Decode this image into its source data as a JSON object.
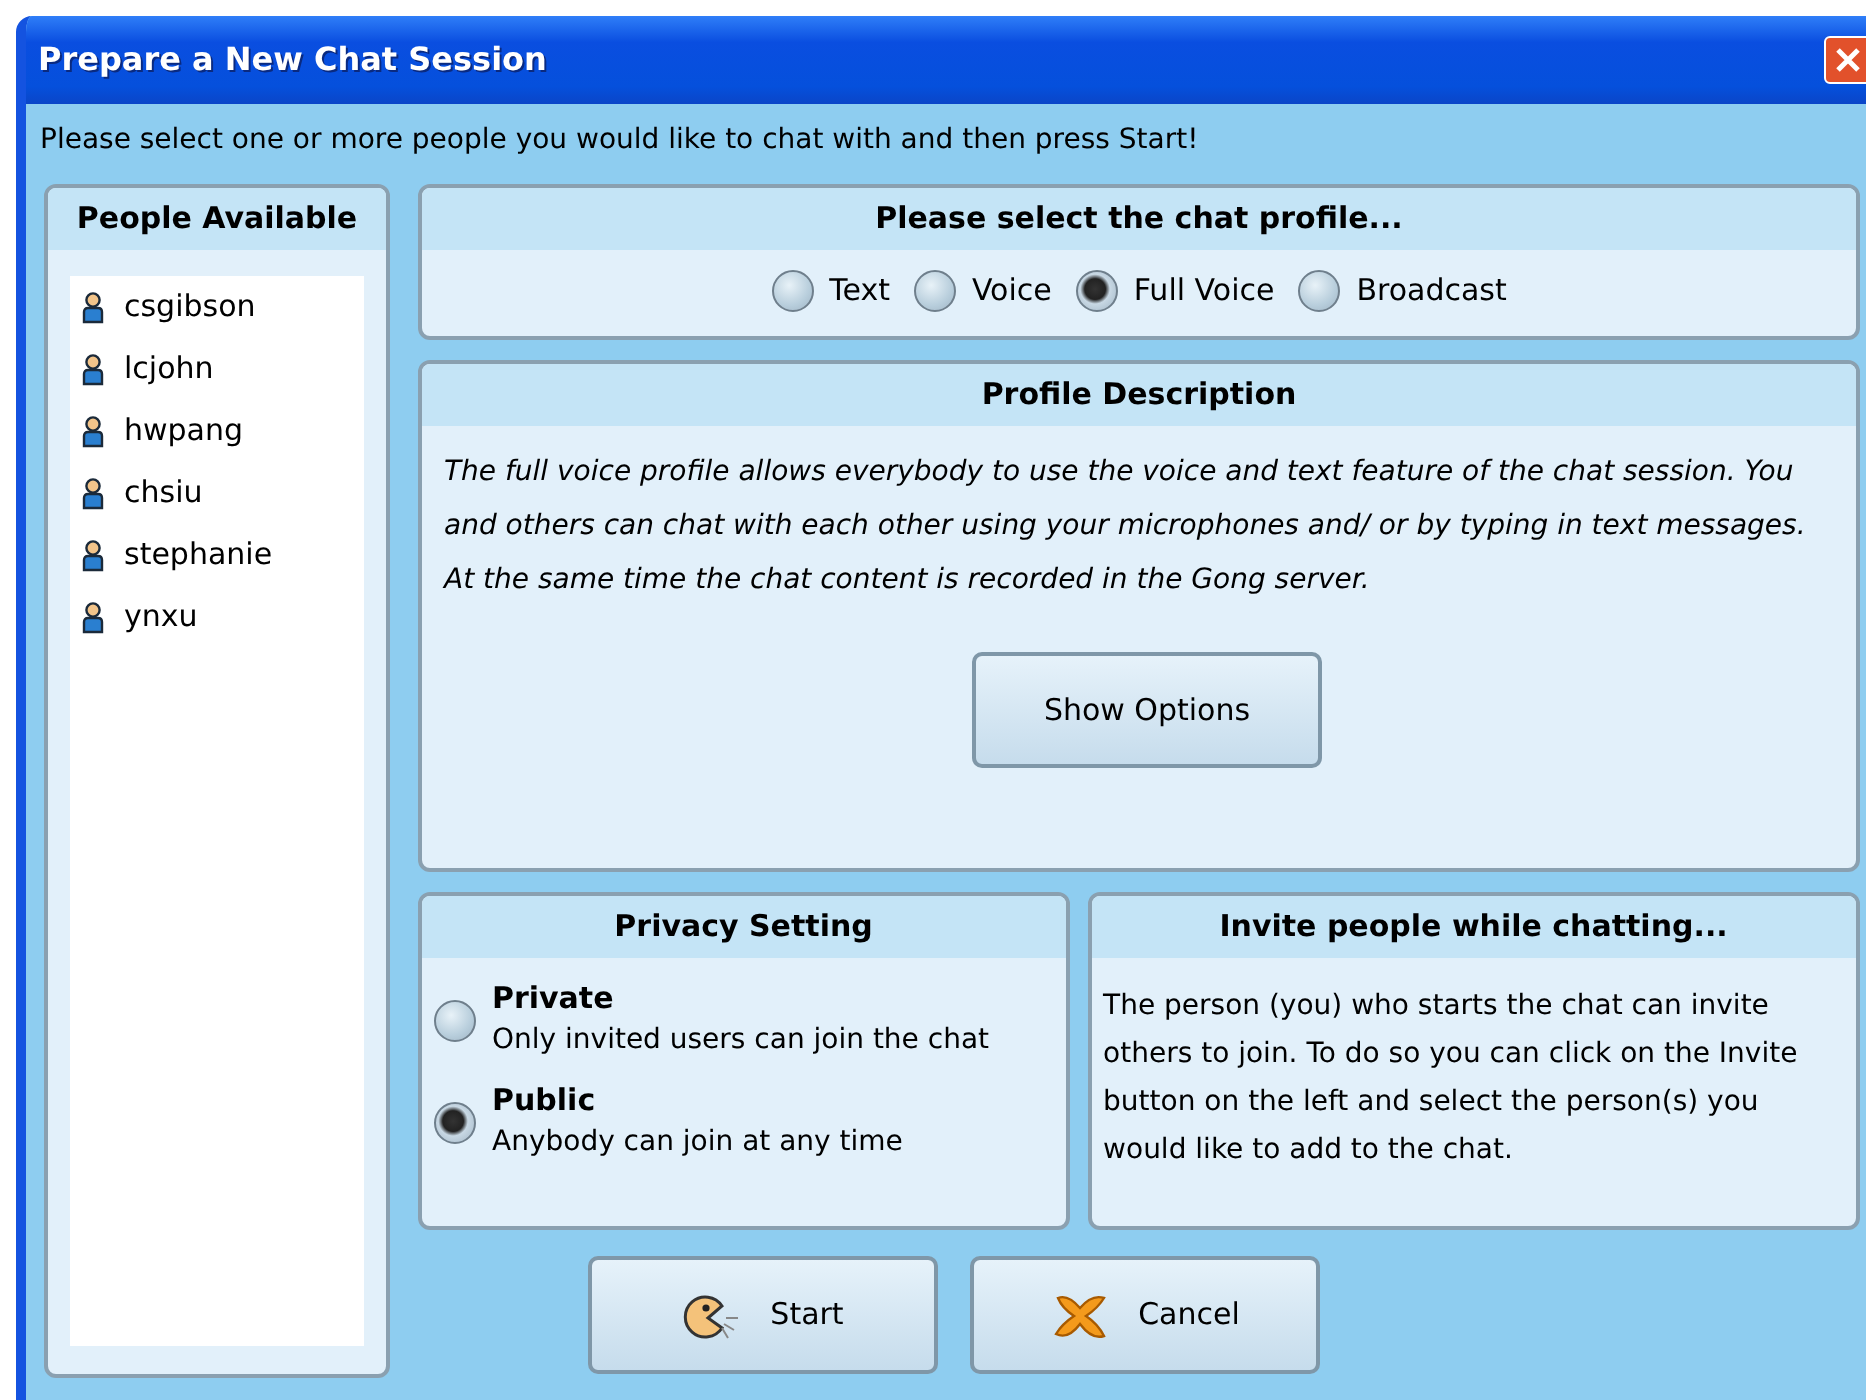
{
  "window": {
    "title": "Prepare a New Chat Session"
  },
  "instruction": "Please select one or more people you would like to chat with and then press Start!",
  "people": {
    "title": "People Available",
    "items": [
      {
        "name": "csgibson"
      },
      {
        "name": "lcjohn"
      },
      {
        "name": "hwpang"
      },
      {
        "name": "chsiu"
      },
      {
        "name": "stephanie"
      },
      {
        "name": "ynxu"
      }
    ]
  },
  "profile": {
    "title": "Please select the chat profile...",
    "options": [
      {
        "label": "Text",
        "selected": false
      },
      {
        "label": "Voice",
        "selected": false
      },
      {
        "label": "Full Voice",
        "selected": true
      },
      {
        "label": "Broadcast",
        "selected": false
      }
    ]
  },
  "description": {
    "title": "Profile Description",
    "paragraphs": [
      "The full voice profile allows everybody to use the voice and text feature of the chat session. You and others can chat with each other using your microphones and/ or by typing in text messages.",
      "At the same time the chat content is recorded in the Gong server."
    ],
    "button": "Show Options"
  },
  "privacy": {
    "title": "Privacy Setting",
    "options": [
      {
        "label": "Private",
        "hint": "Only invited users can join the chat",
        "selected": false
      },
      {
        "label": "Public",
        "hint": "Anybody can join at any time",
        "selected": true
      }
    ]
  },
  "invite": {
    "title": "Invite people while chatting...",
    "text": "The person (you) who starts the chat can invite others to join. To do so you can click on the Invite button on the left and select the person(s) you would like to add to the chat."
  },
  "buttons": [
    {
      "kind": "start",
      "label": "Start"
    },
    {
      "kind": "cancel",
      "label": "Cancel"
    }
  ]
}
